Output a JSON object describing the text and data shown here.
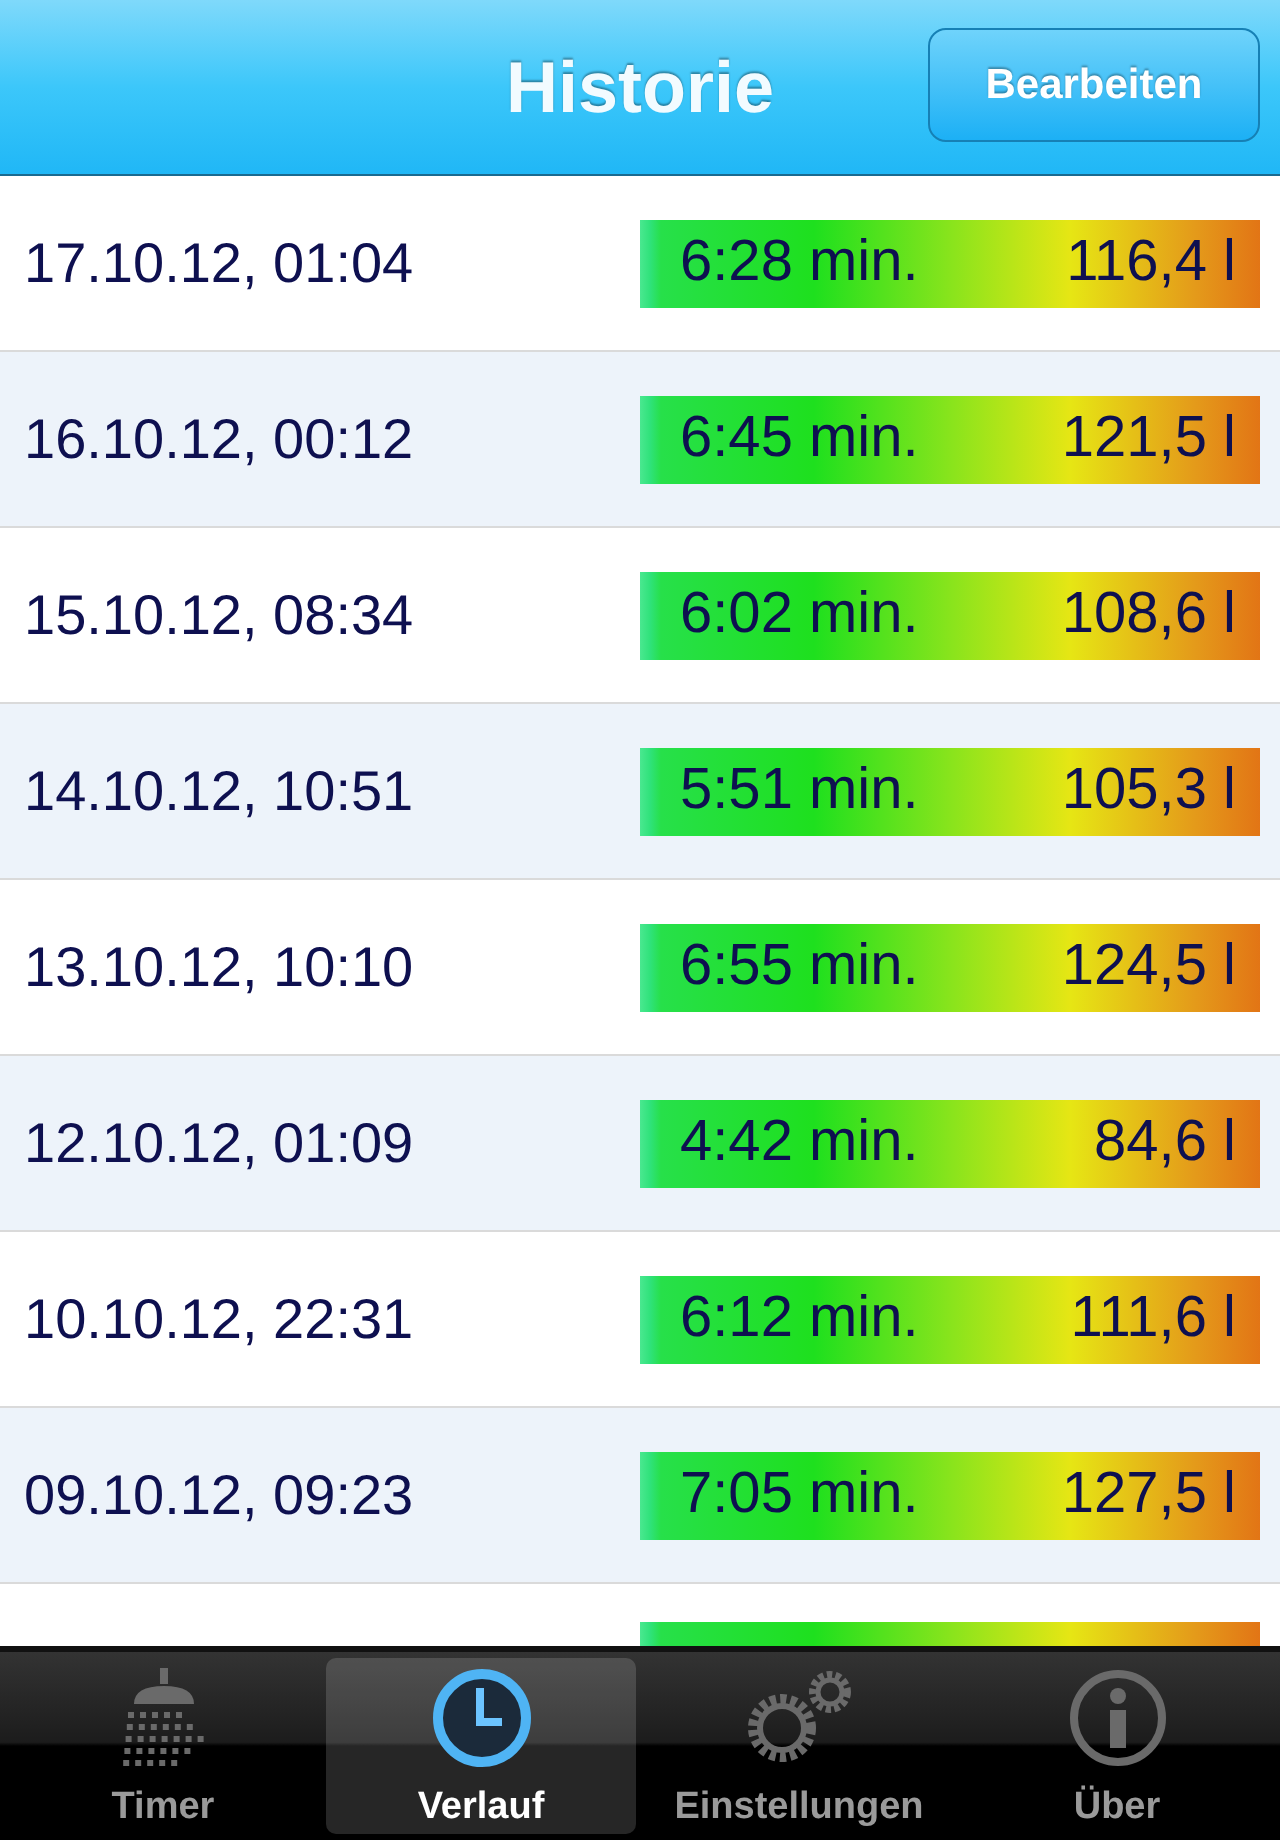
{
  "nav_bar": {
    "title": "Historie",
    "edit_button": "Bearbeiten"
  },
  "rows": [
    {
      "date": "17.10.12, 01:04",
      "duration": "6:28 min.",
      "volume": "116,4 l"
    },
    {
      "date": "16.10.12, 00:12",
      "duration": "6:45 min.",
      "volume": "121,5 l"
    },
    {
      "date": "15.10.12, 08:34",
      "duration": "6:02 min.",
      "volume": "108,6 l"
    },
    {
      "date": "14.10.12, 10:51",
      "duration": "5:51 min.",
      "volume": "105,3 l"
    },
    {
      "date": "13.10.12, 10:10",
      "duration": "6:55 min.",
      "volume": "124,5 l"
    },
    {
      "date": "12.10.12, 01:09",
      "duration": "4:42 min.",
      "volume": "84,6 l"
    },
    {
      "date": "10.10.12, 22:31",
      "duration": "6:12 min.",
      "volume": "111,6 l"
    },
    {
      "date": "09.10.12, 09:23",
      "duration": "7:05 min.",
      "volume": "127,5 l"
    },
    {}
  ],
  "tab_bar": [
    {
      "kind": "shower",
      "label": "Timer",
      "selected": false
    },
    {
      "kind": "clock",
      "label": "Verlauf",
      "selected": true
    },
    {
      "kind": "gears",
      "label": "Einstellungen",
      "selected": false
    },
    {
      "kind": "info",
      "label": "Über",
      "selected": false
    }
  ]
}
